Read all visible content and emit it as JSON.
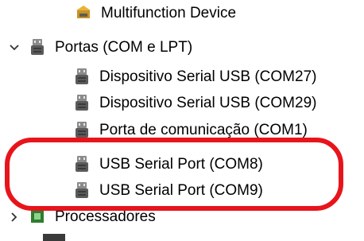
{
  "tree": {
    "items": [
      {
        "label": "Multifunction Device",
        "icon": "multifunction-device-icon",
        "level": 2
      },
      {
        "label": "Portas (COM e LPT)",
        "icon": "port-icon",
        "level": 1,
        "expanded": true
      },
      {
        "label": "Dispositivo Serial USB (COM27)",
        "icon": "port-icon",
        "level": 2
      },
      {
        "label": "Dispositivo Serial USB (COM29)",
        "icon": "port-icon",
        "level": 2
      },
      {
        "label": "Porta de comunicação (COM1)",
        "icon": "port-icon",
        "level": 2
      },
      {
        "label": "USB Serial Port (COM8)",
        "icon": "port-icon",
        "level": 2
      },
      {
        "label": "USB Serial Port (COM9)",
        "icon": "port-icon",
        "level": 2
      },
      {
        "label": "Processadores",
        "icon": "processor-icon",
        "level": 1,
        "expanded": false
      }
    ]
  },
  "annotation": {
    "color": "#e8141b"
  }
}
